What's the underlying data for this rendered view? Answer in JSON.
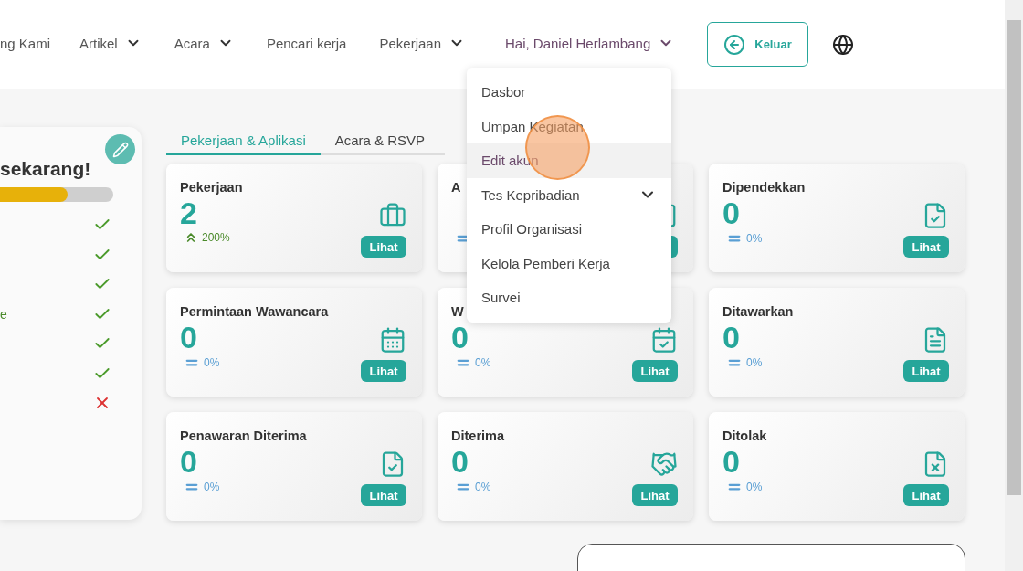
{
  "nav": {
    "items": [
      {
        "label": "ng Kami",
        "dropdown": false
      },
      {
        "label": "Artikel",
        "dropdown": true
      },
      {
        "label": "Acara",
        "dropdown": true
      },
      {
        "label": "Pencari kerja",
        "dropdown": false
      },
      {
        "label": "Pekerjaan",
        "dropdown": true
      }
    ],
    "user": {
      "label": "Hai, Daniel Herlambang",
      "expanded": true
    },
    "logout": "Keluar"
  },
  "user_menu": {
    "items": [
      {
        "label": "Dasbor",
        "hovered": false,
        "submenu": false
      },
      {
        "label": "Umpan Kegiatan",
        "hovered": false,
        "submenu": false
      },
      {
        "label": "Edit akun",
        "hovered": true,
        "submenu": false
      },
      {
        "label": "Tes Kepribadian",
        "hovered": false,
        "submenu": true
      },
      {
        "label": "Profil Organisasi",
        "hovered": false,
        "submenu": false
      },
      {
        "label": "Kelola Pemberi Kerja",
        "hovered": false,
        "submenu": false
      },
      {
        "label": "Survei",
        "hovered": false,
        "submenu": false
      }
    ]
  },
  "profile": {
    "title": "sekarang!",
    "level": 0.6,
    "checklist": [
      {
        "done": true
      },
      {
        "done": true
      },
      {
        "done": true
      },
      {
        "label": "e",
        "done": true
      },
      {
        "done": true
      },
      {
        "done": true
      },
      {
        "done": false
      }
    ]
  },
  "tabs": [
    {
      "label": "Pekerjaan & Aplikasi",
      "selected": true
    },
    {
      "label": "Acara & RSVP",
      "selected": false
    }
  ],
  "cards": [
    {
      "title": "Pekerjaan",
      "value": "2",
      "change": "200%",
      "increased": true,
      "button": "Lihat"
    },
    {
      "title": "A",
      "increased": false
    },
    {
      "title": "Dipendekkan",
      "value": "0",
      "change": "0%",
      "increased": false,
      "button": "Lihat"
    },
    {
      "title": "Permintaan Wawancara",
      "value": "0",
      "change": "0%",
      "increased": false,
      "button": "Lihat"
    },
    {
      "title": "W",
      "value": "0",
      "change": "0%",
      "increased": false,
      "button": "Lihat"
    },
    {
      "title": "Ditawarkan",
      "value": "0",
      "change": "0%",
      "increased": false,
      "button": "Lihat"
    },
    {
      "title": "Penawaran Diterima",
      "value": "0",
      "change": "0%",
      "increased": false,
      "button": "Lihat"
    },
    {
      "title": "Diterima",
      "value": "0",
      "change": "0%",
      "increased": false,
      "button": "Lihat"
    },
    {
      "title": "Ditolak",
      "value": "0",
      "change": "0%",
      "increased": false,
      "button": "Lihat"
    }
  ]
}
